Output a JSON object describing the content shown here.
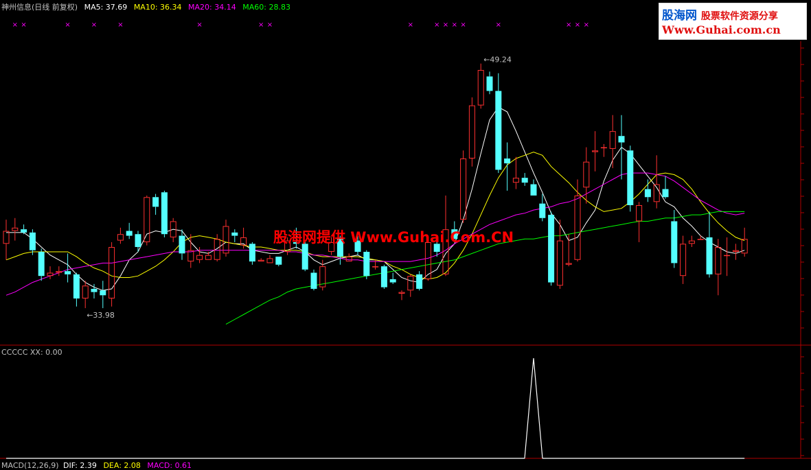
{
  "header": {
    "stock": "神州信息(日线 前复权)",
    "ma5": "MA5: 37.69",
    "ma10": "MA10: 36.34",
    "ma20": "MA20: 34.14",
    "ma60": "MA60: 28.83",
    "indicator": "CCCCC  XX: 0.00",
    "macd_name": "MACD(12,26,9)",
    "dif": "DIF: 2.39",
    "dea": "DEA: 2.08",
    "macd": "MACD: 0.61"
  },
  "logo": {
    "line1a": "股海网",
    "line1b": "股票软件资源分享",
    "line2": "Www.Guhai.com.cn"
  },
  "watermark": "股海网提供 Www.Guhai.Com.CN",
  "colors": {
    "up": "#ff3030",
    "down": "#54ffff",
    "ma5": "#ffffff",
    "ma10": "#ffff00",
    "ma20": "#ff00ff",
    "ma60": "#00ff00",
    "axis": "#b00000",
    "label": "#c0c0c0"
  },
  "chart_data": [
    {
      "type": "candlestick",
      "title": "神州信息(日线 前复权)",
      "annotations": {
        "low": "33.98",
        "high": "49.24"
      },
      "ylim": [
        32,
        52
      ],
      "candles": [
        [
          38.0,
          39.5,
          37.0,
          38.8
        ],
        [
          38.8,
          39.6,
          38.2,
          39.0
        ],
        [
          38.9,
          39.2,
          38.6,
          38.7
        ],
        [
          38.7,
          38.9,
          37.3,
          37.6
        ],
        [
          37.5,
          37.7,
          35.7,
          36.0
        ],
        [
          36.0,
          36.6,
          35.8,
          36.2
        ],
        [
          36.2,
          36.6,
          36.0,
          36.3
        ],
        [
          36.3,
          37.4,
          35.6,
          36.1
        ],
        [
          36.1,
          36.2,
          34.1,
          34.6
        ],
        [
          34.6,
          35.7,
          34.0,
          35.4
        ],
        [
          35.2,
          35.5,
          34.6,
          35.0
        ],
        [
          35.1,
          35.7,
          34.0,
          34.8
        ],
        [
          34.6,
          38.1,
          34.1,
          37.8
        ],
        [
          38.2,
          39.0,
          38.0,
          38.6
        ],
        [
          38.8,
          39.3,
          38.3,
          38.5
        ],
        [
          38.6,
          38.8,
          37.5,
          37.8
        ],
        [
          38.1,
          41.0,
          37.9,
          40.9
        ],
        [
          40.9,
          41.1,
          39.8,
          40.3
        ],
        [
          41.2,
          41.3,
          38.4,
          38.6
        ],
        [
          38.4,
          39.6,
          38.1,
          39.4
        ],
        [
          38.5,
          38.9,
          37.0,
          37.4
        ],
        [
          36.9,
          38.6,
          36.5,
          37.6
        ],
        [
          37.0,
          37.8,
          36.8,
          37.3
        ],
        [
          37.0,
          37.5,
          37.0,
          37.3
        ],
        [
          37.0,
          38.6,
          36.9,
          38.3
        ],
        [
          37.4,
          39.5,
          37.2,
          39.1
        ],
        [
          38.7,
          38.9,
          38.1,
          38.5
        ],
        [
          37.9,
          39.0,
          37.7,
          38.4
        ],
        [
          38.0,
          38.1,
          36.7,
          36.9
        ],
        [
          36.9,
          37.1,
          36.9,
          37.0
        ],
        [
          36.8,
          37.3,
          36.8,
          37.1
        ],
        [
          37.2,
          37.2,
          36.6,
          36.7
        ],
        [
          37.5,
          38.4,
          37.3,
          38.2
        ],
        [
          38.1,
          39.0,
          37.7,
          38.0
        ],
        [
          38.0,
          38.1,
          36.3,
          36.4
        ],
        [
          36.2,
          36.4,
          35.1,
          35.2
        ],
        [
          35.3,
          37.0,
          35.1,
          36.6
        ],
        [
          37.5,
          38.4,
          37.3,
          38.1
        ],
        [
          38.4,
          38.5,
          36.7,
          37.2
        ],
        [
          36.9,
          37.4,
          36.9,
          37.2
        ],
        [
          38.2,
          38.5,
          37.3,
          37.5
        ],
        [
          37.5,
          37.6,
          35.8,
          36.0
        ],
        [
          36.6,
          37.0,
          36.4,
          36.6
        ],
        [
          36.6,
          36.7,
          35.2,
          35.3
        ],
        [
          35.8,
          36.2,
          35.5,
          35.6
        ],
        [
          34.9,
          35.1,
          34.5,
          35.0
        ],
        [
          35.1,
          36.1,
          34.7,
          36.0
        ],
        [
          36.1,
          36.3,
          35.1,
          35.2
        ],
        [
          35.8,
          38.1,
          35.7,
          38.1
        ],
        [
          38.0,
          38.4,
          37.2,
          37.5
        ],
        [
          36.1,
          41.0,
          36.0,
          38.9
        ],
        [
          38.9,
          39.4,
          38.3,
          38.3
        ],
        [
          39.5,
          43.8,
          39.3,
          43.3
        ],
        [
          43.3,
          47.1,
          42.8,
          46.6
        ],
        [
          46.6,
          49.2,
          46.4,
          48.8
        ],
        [
          48.4,
          48.7,
          47.3,
          47.5
        ],
        [
          47.5,
          48.6,
          42.4,
          42.6
        ],
        [
          43.3,
          44.3,
          41.3,
          43.0
        ],
        [
          41.8,
          43.4,
          41.4,
          42.1
        ],
        [
          42.1,
          42.4,
          41.6,
          41.8
        ],
        [
          41.7,
          42.0,
          41.0,
          41.0
        ],
        [
          40.5,
          41.1,
          39.4,
          39.6
        ],
        [
          39.8,
          40.0,
          35.4,
          35.6
        ],
        [
          35.4,
          39.5,
          35.2,
          38.2
        ],
        [
          36.7,
          38.6,
          36.6,
          36.8
        ],
        [
          37.0,
          42.0,
          36.9,
          41.0
        ],
        [
          41.5,
          44.0,
          40.5,
          43.1
        ],
        [
          43.7,
          45.0,
          42.5,
          43.8
        ],
        [
          44.0,
          44.2,
          43.4,
          44.0
        ],
        [
          43.9,
          46.0,
          42.7,
          45.0
        ],
        [
          44.7,
          46.0,
          42.0,
          44.3
        ],
        [
          43.8,
          44.1,
          40.0,
          40.4
        ],
        [
          39.4,
          40.6,
          38.1,
          40.4
        ],
        [
          41.4,
          42.0,
          40.6,
          40.9
        ],
        [
          40.6,
          43.5,
          40.2,
          41.7
        ],
        [
          41.4,
          42.2,
          40.8,
          40.9
        ],
        [
          39.4,
          40.1,
          36.5,
          36.8
        ],
        [
          36.0,
          38.5,
          35.5,
          38.0
        ],
        [
          38.0,
          38.5,
          37.8,
          38.2
        ],
        [
          38.3,
          38.5,
          38.3,
          38.3
        ],
        [
          38.4,
          40.0,
          35.9,
          36.1
        ],
        [
          36.1,
          38.3,
          34.8,
          37.8
        ],
        [
          37.3,
          38.4,
          36.0,
          37.3
        ],
        [
          37.5,
          38.0,
          37.0,
          37.6
        ],
        [
          37.4,
          39.0,
          37.2,
          38.3
        ]
      ],
      "series": [
        {
          "name": "MA5",
          "values": [
            38.7,
            38.7,
            38.7,
            38.3,
            37.8,
            37.3,
            37.0,
            36.7,
            36.1,
            35.6,
            35.3,
            35.1,
            35.2,
            36.0,
            37.0,
            37.5,
            38.6,
            38.8,
            38.7,
            38.9,
            38.8,
            38.1,
            37.5,
            37.4,
            37.7,
            38.1,
            38.0,
            38.0,
            37.6,
            37.5,
            37.4,
            37.4,
            37.6,
            37.8,
            37.5,
            37.0,
            36.7,
            36.9,
            37.1,
            37.2,
            37.3,
            37.0,
            37.0,
            36.9,
            36.4,
            35.9,
            35.7,
            35.6,
            36.1,
            36.4,
            37.4,
            38.0,
            39.5,
            41.4,
            43.6,
            45.7,
            46.5,
            46.2,
            45.0,
            43.7,
            42.4,
            41.2,
            39.9,
            39.2,
            38.2,
            38.4,
            39.3,
            40.1,
            41.9,
            43.2,
            44.0,
            43.6,
            42.9,
            42.2,
            41.5,
            40.6,
            40.3,
            39.6,
            39.1,
            38.5,
            38.1,
            37.8,
            37.5,
            37.4,
            37.6
          ]
        },
        {
          "name": "MA10",
          "values": [
            37.0,
            37.2,
            37.4,
            37.5,
            37.5,
            37.5,
            37.5,
            37.5,
            37.2,
            36.8,
            36.5,
            36.3,
            36.0,
            35.9,
            35.9,
            36.0,
            36.3,
            36.6,
            37.0,
            37.5,
            38.1,
            38.4,
            38.5,
            38.4,
            38.3,
            38.1,
            38.0,
            37.9,
            37.8,
            37.8,
            37.7,
            37.6,
            37.6,
            37.6,
            37.5,
            37.3,
            37.2,
            37.2,
            37.2,
            37.2,
            37.2,
            37.1,
            37.0,
            36.9,
            36.6,
            36.4,
            36.1,
            35.9,
            35.8,
            35.9,
            36.2,
            36.8,
            37.6,
            38.6,
            39.8,
            41.0,
            42.1,
            42.9,
            43.3,
            43.5,
            43.7,
            43.5,
            42.8,
            42.3,
            41.8,
            41.2,
            40.7,
            40.3,
            40.0,
            40.1,
            40.2,
            40.6,
            41.1,
            41.7,
            42.3,
            42.4,
            42.3,
            42.0,
            41.4,
            40.6,
            39.9,
            39.3,
            38.8,
            38.4,
            38.2
          ]
        },
        {
          "name": "MA20",
          "values": [
            34.8,
            35.0,
            35.3,
            35.6,
            35.8,
            36.0,
            36.2,
            36.4,
            36.5,
            36.6,
            36.7,
            36.8,
            36.8,
            36.9,
            37.0,
            37.1,
            37.2,
            37.3,
            37.4,
            37.5,
            37.5,
            37.5,
            37.6,
            37.6,
            37.6,
            37.6,
            37.6,
            37.6,
            37.6,
            37.6,
            37.6,
            37.6,
            37.5,
            37.5,
            37.4,
            37.3,
            37.3,
            37.2,
            37.1,
            37.0,
            37.0,
            36.9,
            36.9,
            36.9,
            36.9,
            36.9,
            36.9,
            37.0,
            37.1,
            37.3,
            37.6,
            38.0,
            38.3,
            38.6,
            38.9,
            39.2,
            39.4,
            39.6,
            39.8,
            39.9,
            40.1,
            40.2,
            40.3,
            40.5,
            40.6,
            40.8,
            41.1,
            41.4,
            41.7,
            42.0,
            42.3,
            42.4,
            42.4,
            42.4,
            42.3,
            42.2,
            41.9,
            41.5,
            41.1,
            40.7,
            40.4,
            40.1,
            39.9,
            39.8,
            39.9
          ]
        },
        {
          "name": "MA60",
          "values": [
            null,
            null,
            null,
            null,
            null,
            null,
            null,
            null,
            null,
            null,
            null,
            null,
            null,
            null,
            null,
            null,
            null,
            null,
            null,
            null,
            null,
            null,
            null,
            null,
            null,
            33.0,
            33.3,
            33.6,
            33.9,
            34.2,
            34.5,
            34.7,
            35.0,
            35.2,
            35.3,
            35.4,
            35.5,
            35.6,
            35.7,
            35.8,
            35.9,
            36.0,
            36.1,
            36.2,
            36.3,
            36.4,
            36.5,
            36.6,
            36.7,
            36.8,
            36.9,
            37.0,
            37.2,
            37.4,
            37.6,
            37.8,
            38.0,
            38.1,
            38.2,
            38.3,
            38.3,
            38.4,
            38.5,
            38.5,
            38.6,
            38.7,
            38.8,
            38.9,
            39.0,
            39.1,
            39.2,
            39.3,
            39.4,
            39.4,
            39.5,
            39.6,
            39.6,
            39.7,
            39.8,
            39.8,
            39.9,
            40.0,
            40.0,
            40.0,
            40.0
          ]
        }
      ],
      "markers": [
        1,
        2,
        7,
        10,
        13,
        22,
        29,
        30,
        46,
        49,
        50,
        51,
        52,
        56,
        64,
        65,
        66
      ]
    },
    {
      "type": "line",
      "title": "CCCCC",
      "series": [
        {
          "name": "XX",
          "values": [
            0,
            0,
            0,
            0,
            0,
            0,
            0,
            0,
            0,
            0,
            0,
            0,
            0,
            0,
            0,
            0,
            0,
            0,
            0,
            0,
            0,
            0,
            0,
            0,
            0,
            0,
            0,
            0,
            0,
            0,
            0,
            0,
            0,
            0,
            0,
            0,
            0,
            0,
            0,
            0,
            0,
            0,
            0,
            0,
            0,
            0,
            0,
            0,
            0,
            0,
            0,
            0,
            0,
            0,
            0,
            0,
            0,
            0,
            0,
            0,
            1,
            0,
            0,
            0,
            0,
            0,
            0,
            0,
            0,
            0,
            0,
            0,
            0,
            0,
            0,
            0,
            0,
            0,
            0,
            0,
            0,
            0,
            0,
            0,
            0
          ]
        }
      ]
    }
  ]
}
